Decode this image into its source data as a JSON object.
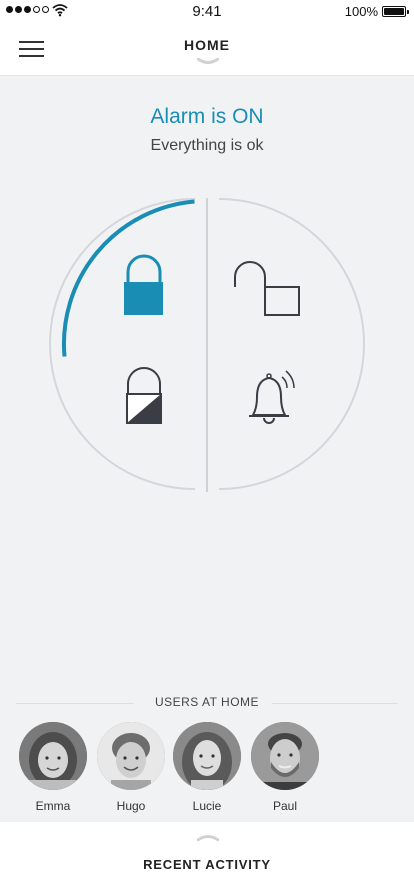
{
  "status_bar": {
    "time": "9:41",
    "battery": "100%",
    "signal_icon": "signal-dots-icon",
    "wifi_icon": "wifi-icon",
    "battery_icon": "battery-icon"
  },
  "header": {
    "title": "HOME",
    "menu_icon": "hamburger-menu-icon",
    "collapse_icon": "chevron-down-icon"
  },
  "alarm": {
    "status": "Alarm is ON",
    "message": "Everything is ok",
    "accent_color": "#1a8db5",
    "progress_arc_fraction": 0.25,
    "modes": [
      {
        "icon": "lock-closed-icon",
        "active": true
      },
      {
        "icon": "lock-open-icon",
        "active": false
      },
      {
        "icon": "lock-partial-icon",
        "active": false
      },
      {
        "icon": "bell-alarm-icon",
        "active": false
      }
    ]
  },
  "users": {
    "heading": "USERS AT HOME",
    "list": [
      {
        "name": "Emma",
        "icon": "avatar-emma"
      },
      {
        "name": "Hugo",
        "icon": "avatar-hugo"
      },
      {
        "name": "Lucie",
        "icon": "avatar-lucie"
      },
      {
        "name": "Paul",
        "icon": "avatar-paul"
      }
    ]
  },
  "bottom": {
    "label": "RECENT ACTIVITY",
    "expand_icon": "chevron-up-icon"
  }
}
